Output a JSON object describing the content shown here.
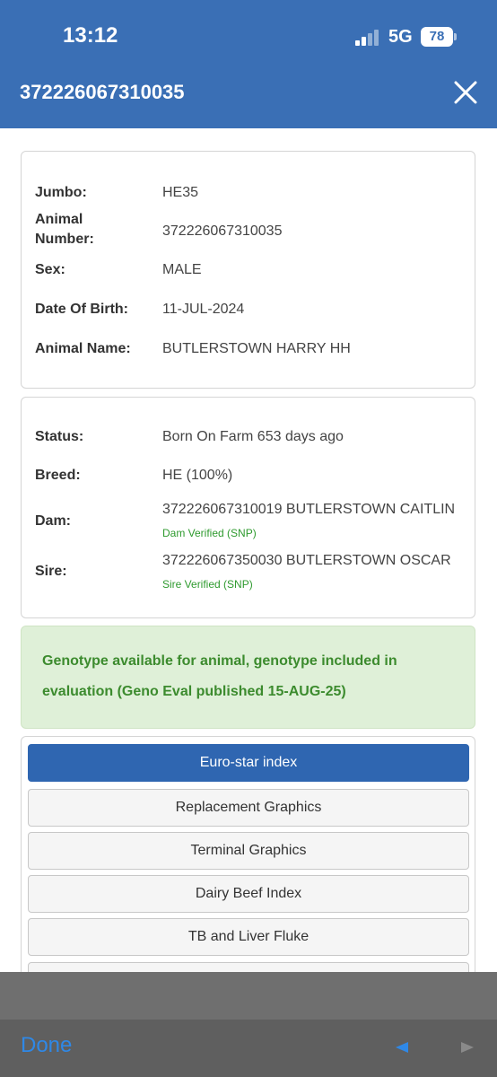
{
  "status_bar": {
    "time": "13:12",
    "network": "5G",
    "battery": "78"
  },
  "header": {
    "title": "372226067310035"
  },
  "details": [
    {
      "label": "Jumbo:",
      "value": "HE35"
    },
    {
      "label": "Animal Number:",
      "value": "372226067310035"
    },
    {
      "label": "Sex:",
      "value": "MALE"
    },
    {
      "label": "Date Of Birth:",
      "value": "11-JUL-2024"
    },
    {
      "label": "Animal Name:",
      "value": "BUTLERSTOWN HARRY HH"
    }
  ],
  "pedigree": {
    "status": {
      "label": "Status:",
      "value": "Born On Farm 653 days ago"
    },
    "breed": {
      "label": "Breed:",
      "value": "HE (100%)"
    },
    "dam": {
      "label": "Dam:",
      "value": "372226067310019 BUTLERSTOWN CAITLIN",
      "badge": "Dam Verified (SNP)"
    },
    "sire": {
      "label": "Sire:",
      "value": "372226067350030 BUTLERSTOWN OSCAR",
      "badge": "Sire Verified (SNP)"
    }
  },
  "genotype_notice": "Genotype available for animal, genotype included in evaluation (Geno Eval published 15-AUG-25)",
  "tabs": [
    {
      "label": "Euro-star index",
      "active": true
    },
    {
      "label": "Replacement Graphics"
    },
    {
      "label": "Terminal Graphics"
    },
    {
      "label": "Dairy Beef Index"
    },
    {
      "label": "TB and Liver Fluke"
    }
  ],
  "toolbar": {
    "done_label": "Done",
    "prev_icon": "triangle-left-icon",
    "next_icon": "triangle-right-icon"
  },
  "colors": {
    "header": "#3a6fb5",
    "active_tab": "#2f66b1",
    "verified": "#2e9a2e",
    "notice_bg": "#dff0d8",
    "done": "#2f88e6"
  }
}
